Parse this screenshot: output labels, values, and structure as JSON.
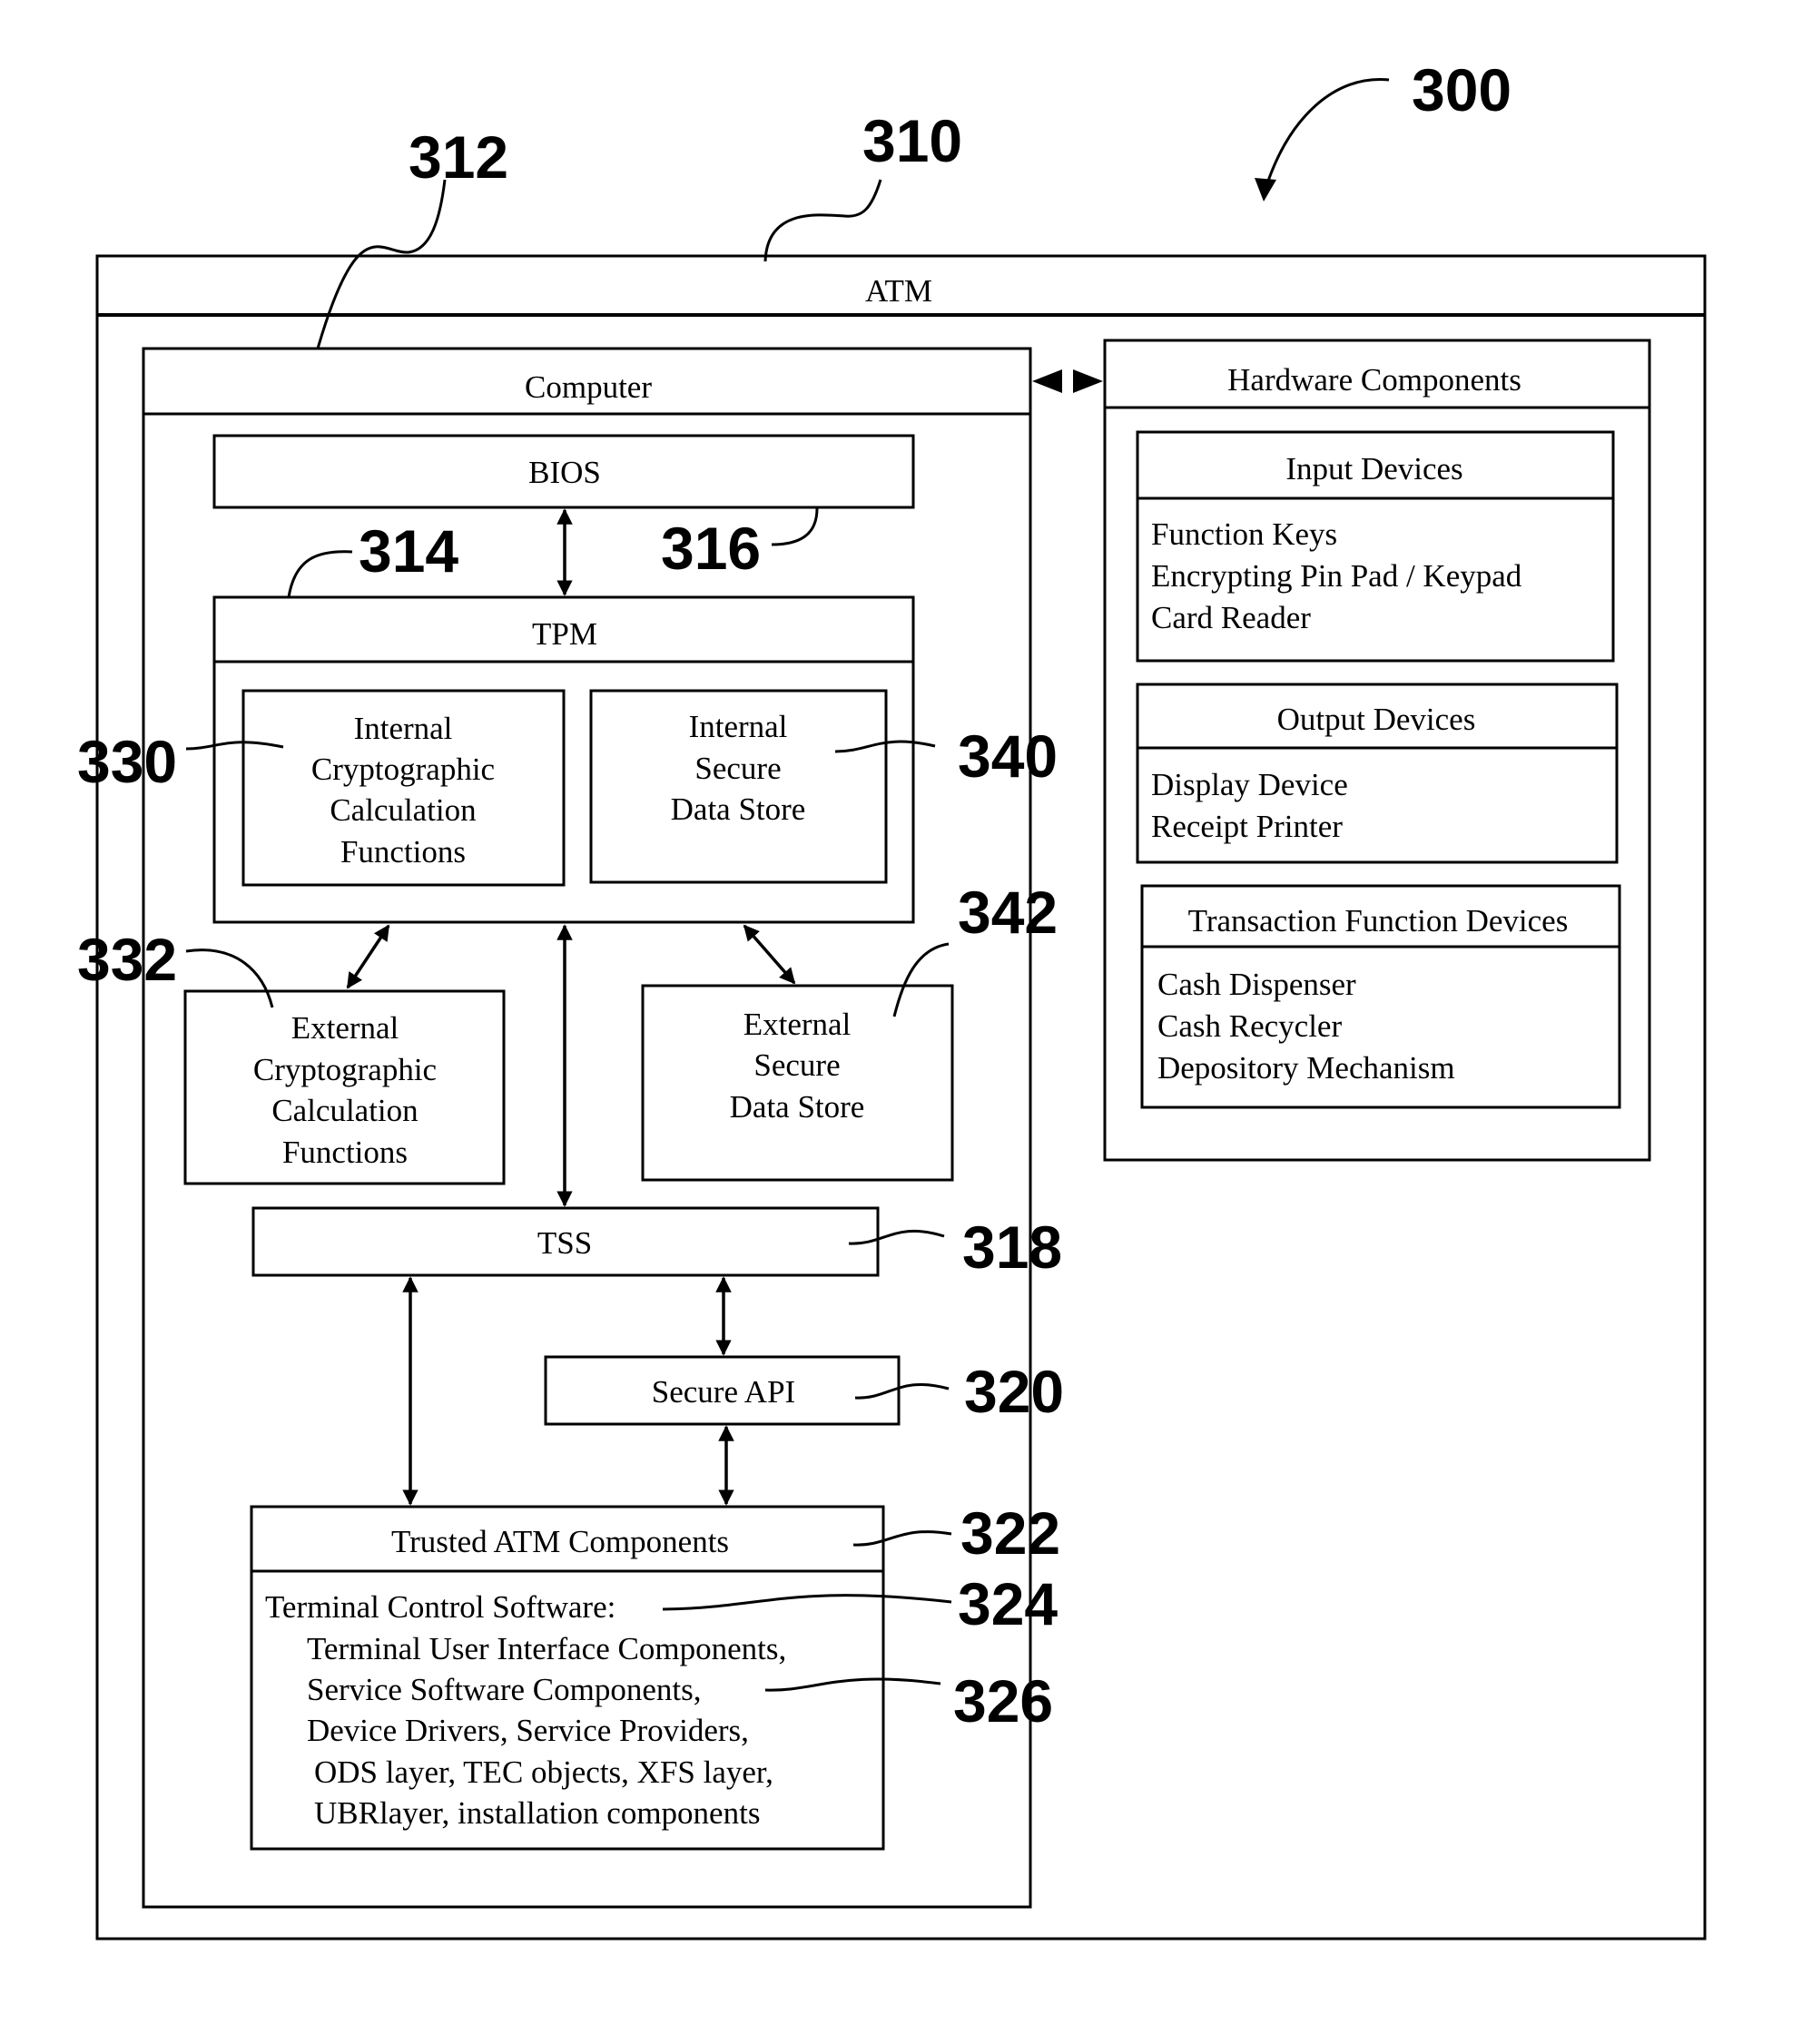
{
  "figure": {
    "ref_label": "300",
    "atm": {
      "title": "ATM",
      "ref": "310"
    },
    "computer": {
      "title": "Computer",
      "ref": "312",
      "bios": {
        "title": "BIOS",
        "link_ref": "316"
      },
      "tpm": {
        "title": "TPM",
        "ref": "314",
        "internal_crypto": {
          "lines": [
            "Internal",
            "Cryptographic",
            "Calculation",
            "Functions"
          ],
          "ref": "330"
        },
        "internal_store": {
          "lines": [
            "Internal",
            "Secure",
            "Data Store"
          ],
          "ref": "340"
        }
      },
      "external_crypto": {
        "lines": [
          "External",
          "Cryptographic",
          "Calculation",
          "Functions"
        ],
        "ref": "332"
      },
      "external_store": {
        "lines": [
          "External",
          "Secure",
          "Data Store"
        ],
        "ref": "342"
      },
      "tss": {
        "title": "TSS",
        "ref": "318"
      },
      "secure_api": {
        "title": "Secure  API",
        "ref": "320"
      },
      "trusted": {
        "title": "Trusted ATM Components",
        "ref": "322",
        "tcs_label": "Terminal Control Software:",
        "tcs_ref": "324",
        "items": [
          "Terminal User Interface Components,",
          "Service Software Components,",
          "Device Drivers, Service Providers,",
          "ODS layer,  TEC objects,  XFS layer,",
          "UBRlayer, installation components"
        ],
        "service_ref": "326"
      }
    },
    "hardware": {
      "title": "Hardware Components",
      "groups": [
        {
          "title": "Input Devices",
          "items": [
            "Function Keys",
            "Encrypting Pin Pad / Keypad",
            "Card Reader"
          ]
        },
        {
          "title": "Output Devices",
          "items": [
            "Display Device",
            "Receipt Printer"
          ]
        },
        {
          "title": "Transaction Function Devices",
          "items": [
            "Cash Dispenser",
            "Cash Recycler",
            "Depository Mechanism"
          ]
        }
      ]
    }
  }
}
